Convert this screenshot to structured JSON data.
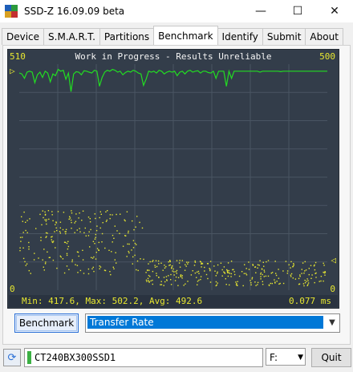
{
  "window": {
    "title": "SSD-Z 16.09.09 beta",
    "minimize": "—",
    "maximize": "☐",
    "close": "✕"
  },
  "tabs": [
    "Device",
    "S.M.A.R.T.",
    "Partitions",
    "Benchmark",
    "Identify",
    "Submit",
    "About"
  ],
  "active_tab": "Benchmark",
  "chart": {
    "header": "Work in Progress - Results Unreliable",
    "left_max": "510",
    "right_max": "500",
    "left_min": "0",
    "right_min": "0",
    "marker_left": "▷",
    "marker_right": "◁",
    "stats": "Min: 417.6, Max: 502.2, Avg: 492.6",
    "latency": "0.077 ms",
    "colors": {
      "background": "#333d4a",
      "rate_line": "#22dd22",
      "latency_dots": "#e8e830",
      "grid": "#4a5563"
    }
  },
  "chart_data": {
    "type": "line",
    "title": "",
    "series": [
      {
        "values": [
          490,
          488,
          478,
          492,
          494,
          492,
          468,
          486,
          492,
          480,
          494,
          490,
          470,
          488,
          484,
          498,
          494,
          496,
          476,
          490,
          448,
          488,
          493,
          492,
          486,
          495,
          494,
          492,
          490,
          496,
          494,
          460,
          480,
          492,
          496,
          494,
          498,
          496,
          492,
          494,
          486,
          491,
          494,
          492,
          496,
          494,
          490,
          488,
          462,
          476,
          494,
          492,
          494,
          490,
          496,
          494,
          488,
          492,
          494,
          492,
          494,
          484,
          492,
          494,
          488,
          494,
          496,
          492,
          494,
          495,
          490,
          494,
          494,
          491,
          490,
          494,
          478,
          494,
          494,
          494,
          460,
          494,
          478,
          494,
          494,
          494,
          494,
          494,
          494,
          494,
          494,
          494,
          494,
          492,
          494,
          494,
          494,
          494,
          494,
          494,
          494,
          493,
          494,
          494,
          494,
          494,
          494,
          494,
          494,
          494,
          494,
          494,
          494,
          494,
          494,
          494,
          494,
          494,
          494,
          494
        ]
      },
      {
        "values": []
      }
    ],
    "ylim": [
      0,
      510
    ],
    "stats": {
      "min": 417.6,
      "max": 502.2,
      "avg": 492.6
    }
  },
  "controls": {
    "benchmark_button": "Benchmark",
    "mode_select": "Transfer Rate"
  },
  "status": {
    "drive_name": "CT240BX300SSD1",
    "drive_letter": "F:",
    "quit_button": "Quit"
  }
}
